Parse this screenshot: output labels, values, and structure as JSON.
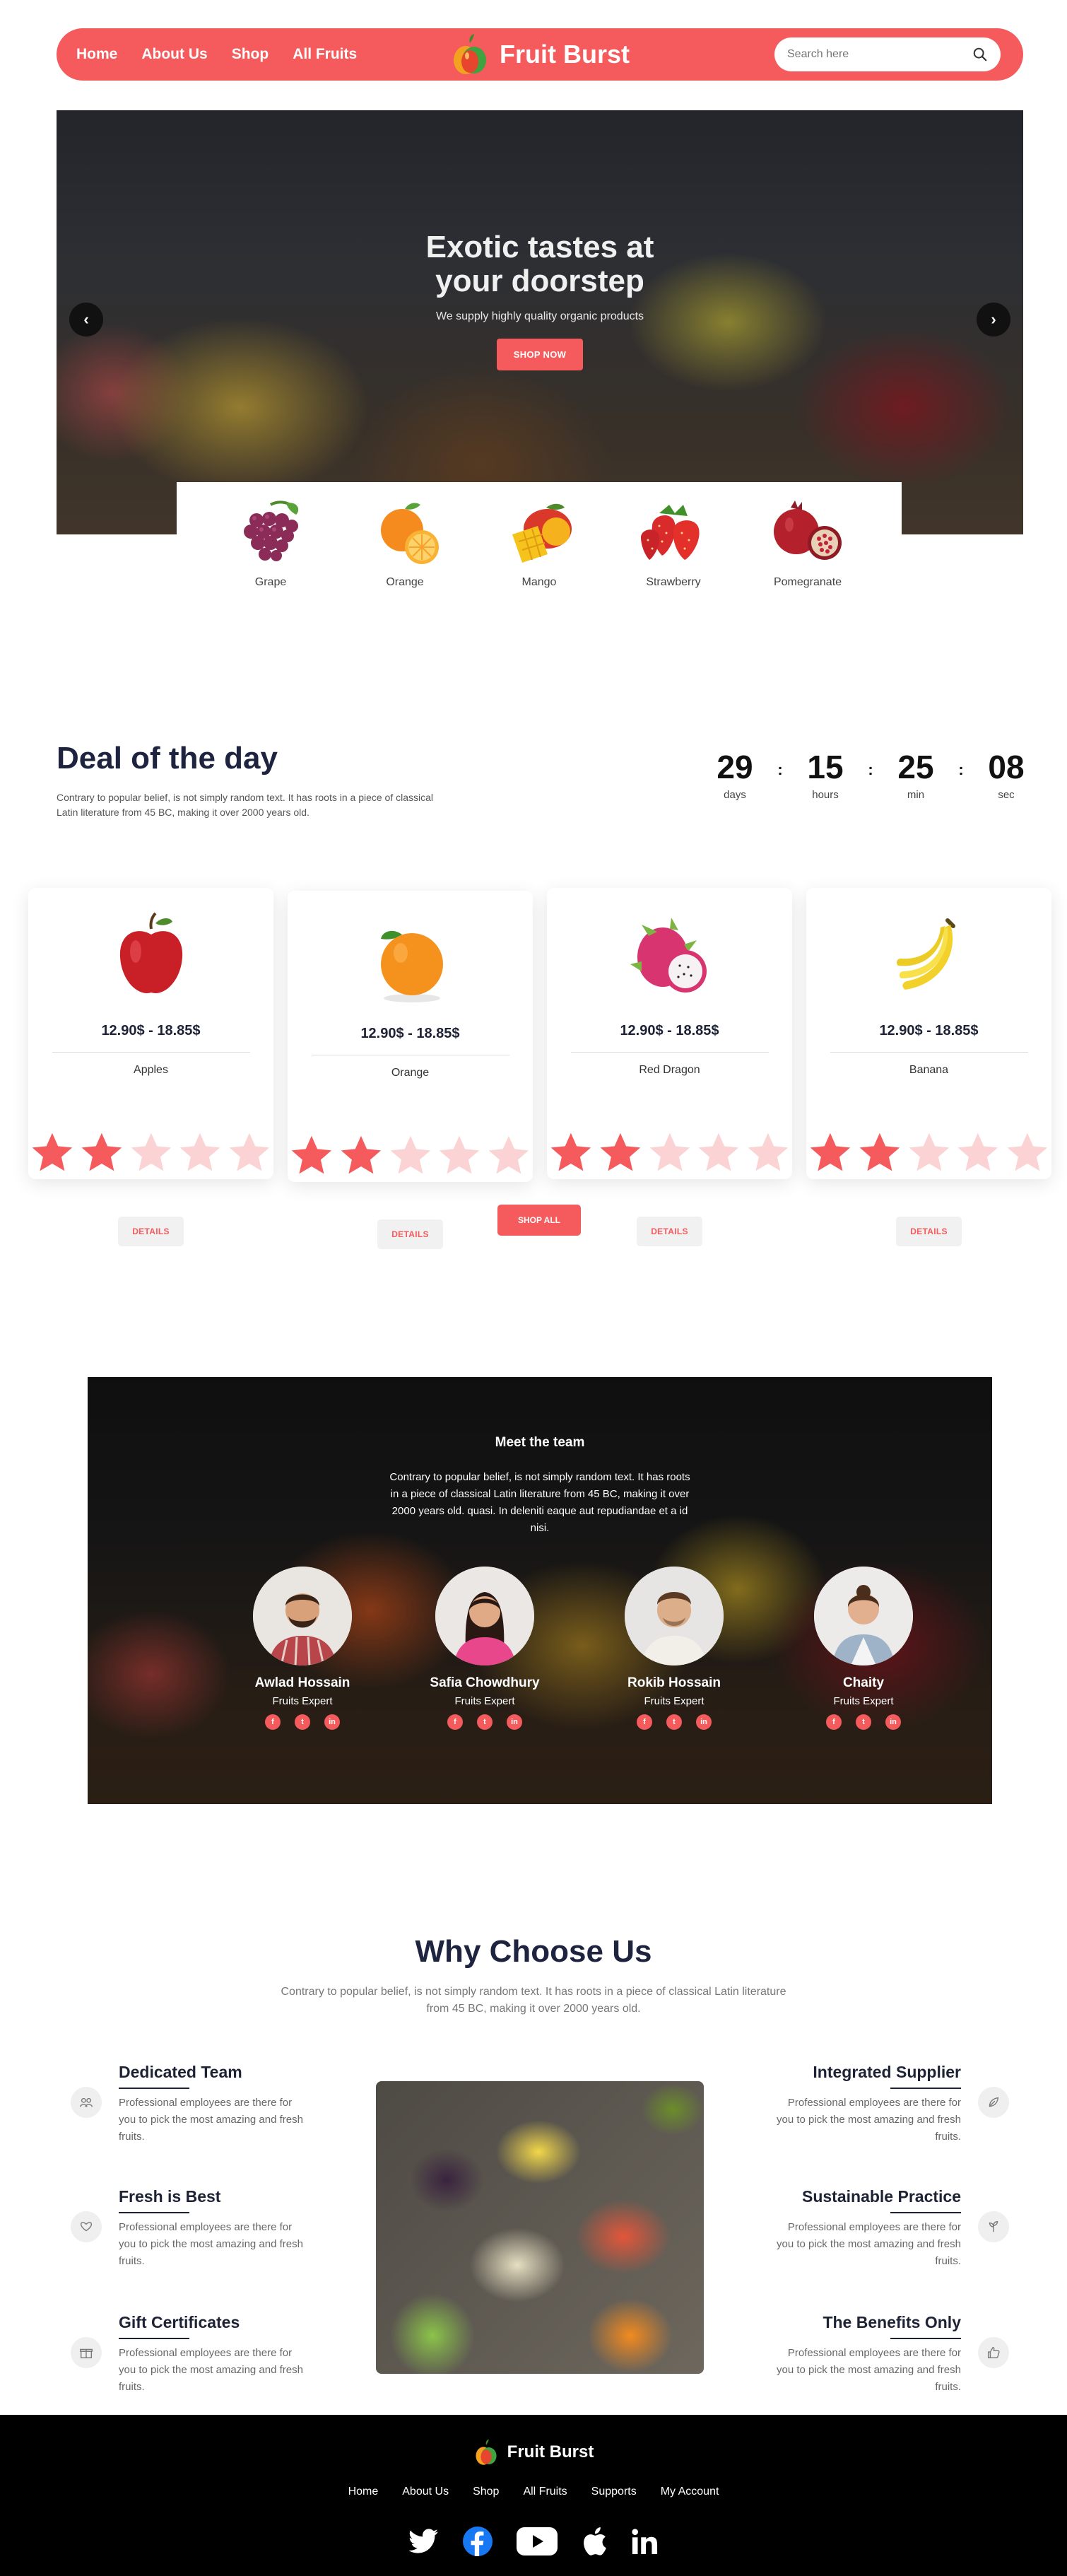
{
  "nav": {
    "links": [
      "Home",
      "About Us",
      "Shop",
      "All Fruits"
    ],
    "brand": "Fruit Burst",
    "search_placeholder": "Search here"
  },
  "hero": {
    "title": "Exotic tastes at your doorstep",
    "subtitle": "We supply highly quality organic products",
    "cta": "SHOP NOW",
    "prev_icon": "chevron-left-icon",
    "next_icon": "chevron-right-icon"
  },
  "categories": [
    "Grape",
    "Orange",
    "Mango",
    "Strawberry",
    "Pomegranate"
  ],
  "deal": {
    "title": "Deal of the day",
    "description": "Contrary to popular belief, is not simply random text. It has roots in a piece of classical Latin literature from 45 BC, making it over 2000 years old.",
    "countdown": [
      {
        "value": "29",
        "label": "days"
      },
      {
        "value": "15",
        "label": "hours"
      },
      {
        "value": "25",
        "label": "min"
      },
      {
        "value": "08",
        "label": "sec"
      }
    ],
    "products": [
      {
        "name": "Apples",
        "price": "12.90$ - 18.85$",
        "rating": 2,
        "details": "DETAILS"
      },
      {
        "name": "Orange",
        "price": "12.90$ - 18.85$",
        "rating": 2,
        "details": "DETAILS"
      },
      {
        "name": "Red Dragon",
        "price": "12.90$ - 18.85$",
        "rating": 2,
        "details": "DETAILS"
      },
      {
        "name": "Banana",
        "price": "12.90$ - 18.85$",
        "rating": 2,
        "details": "DETAILS"
      }
    ],
    "shop_all": "SHOP ALL"
  },
  "team": {
    "title": "Meet the team",
    "description": "Contrary to popular belief, is not simply random text. It has roots in a piece of classical Latin literature from 45 BC, making it over 2000 years old. quasi. In deleniti eaque aut repudiandae et a id nisi.",
    "members": [
      {
        "name": "Awlad Hossain",
        "role": "Fruits Expert"
      },
      {
        "name": "Safia Chowdhury",
        "role": "Fruits Expert"
      },
      {
        "name": "Rokib Hossain",
        "role": "Fruits Expert"
      },
      {
        "name": "Chaity",
        "role": "Fruits Expert"
      }
    ],
    "social_icons": [
      "facebook-icon",
      "twitter-icon",
      "linkedin-icon"
    ]
  },
  "why": {
    "title": "Why Choose Us",
    "description": "Contrary to popular belief, is not simply random text. It has roots in a piece of classical Latin literature from 45 BC, making it over 2000 years old.",
    "left": [
      {
        "title": "Dedicated Team",
        "text": "Professional employees are there for you to pick the most amazing and fresh fruits.",
        "icon": "team-icon"
      },
      {
        "title": "Fresh is Best",
        "text": "Professional employees are there for you to pick the most amazing and fresh fruits.",
        "icon": "heart-hand-icon"
      },
      {
        "title": "Gift Certificates",
        "text": "Professional employees are there for you to pick the most amazing and fresh fruits.",
        "icon": "gift-icon"
      }
    ],
    "right": [
      {
        "title": "Integrated Supplier",
        "text": "Professional employees are there for you to pick the most amazing and fresh fruits.",
        "icon": "leaf-hand-icon"
      },
      {
        "title": "Sustainable Practice",
        "text": "Professional employees are there for you to pick the most amazing and fresh fruits.",
        "icon": "sprout-icon"
      },
      {
        "title": "The Benefits Only",
        "text": "Professional employees are there for you to pick the most amazing and fresh fruits.",
        "icon": "thumbs-up-icon"
      }
    ]
  },
  "footer": {
    "brand": "Fruit Burst",
    "links": [
      "Home",
      "About Us",
      "Shop",
      "All Fruits",
      "Supports",
      "My Account"
    ],
    "social_icons": [
      "twitter-icon",
      "facebook-icon",
      "youtube-icon",
      "apple-icon",
      "linkedin-icon"
    ]
  },
  "colors": {
    "accent": "#f55a5c",
    "dark": "#1e2440",
    "footer": "#000000"
  }
}
